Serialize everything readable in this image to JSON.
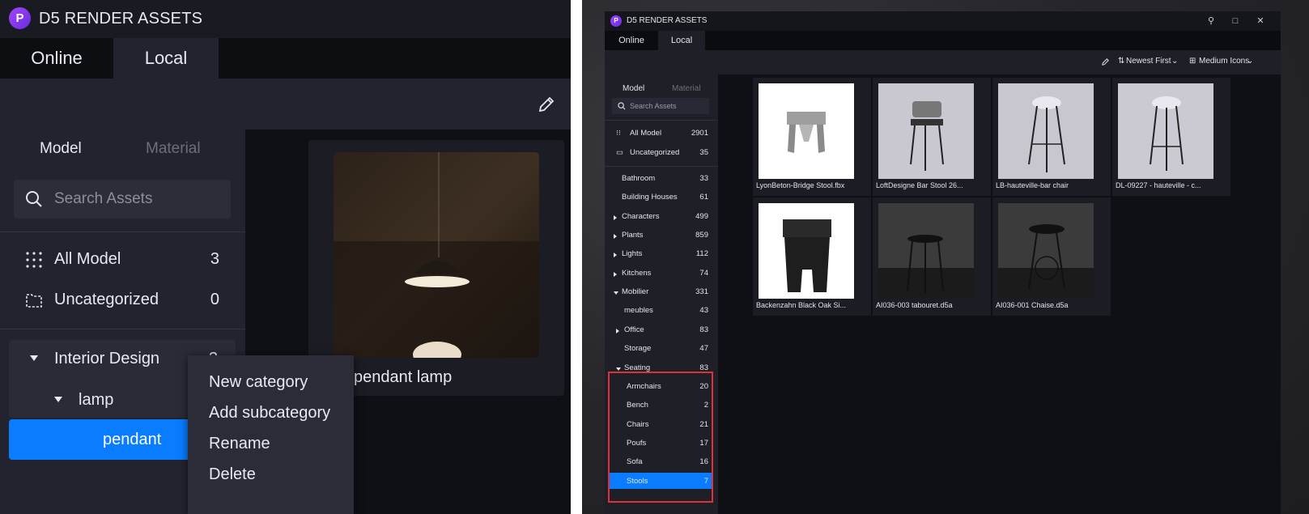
{
  "left": {
    "app_title": "D5 RENDER ASSETS",
    "logo_letter": "P",
    "tabs": {
      "online": "Online",
      "local": "Local"
    },
    "sidebar_tabs": {
      "model": "Model",
      "material": "Material"
    },
    "search_placeholder": "Search Assets",
    "all_model": {
      "label": "All Model",
      "count": "3"
    },
    "uncategorized": {
      "label": "Uncategorized",
      "count": "0"
    },
    "tree": {
      "interior_design": {
        "label": "Interior Design",
        "count": "3"
      },
      "lamp": "lamp",
      "pendant": "pendant"
    },
    "card_label": "pendant lamp",
    "context_menu": [
      "New category",
      "Add subcategory",
      "Rename",
      "Delete"
    ]
  },
  "right": {
    "app_title": "D5 RENDER ASSETS",
    "logo_letter": "P",
    "tabs": {
      "online": "Online",
      "local": "Local"
    },
    "toolbar": {
      "sort": "Newest First",
      "view": "Medium Icons"
    },
    "sidebar_tabs": {
      "model": "Model",
      "material": "Material"
    },
    "search_placeholder": "Search Assets",
    "all_model": {
      "label": "All Model",
      "count": "2901"
    },
    "uncategorized": {
      "label": "Uncategorized",
      "count": "35"
    },
    "categories": [
      {
        "label": "Bathroom",
        "count": "33"
      },
      {
        "label": "Building Houses",
        "count": "61"
      },
      {
        "label": "Characters",
        "count": "499"
      },
      {
        "label": "Plants",
        "count": "859"
      },
      {
        "label": "Lights",
        "count": "112"
      },
      {
        "label": "Kitchens",
        "count": "74"
      },
      {
        "label": "Mobilier",
        "count": "331"
      },
      {
        "label": "meubles",
        "count": "43"
      },
      {
        "label": "Office",
        "count": "83"
      },
      {
        "label": "Storage",
        "count": "47"
      },
      {
        "label": "Seating",
        "count": "83"
      },
      {
        "label": "Armchairs",
        "count": "20"
      },
      {
        "label": "Bench",
        "count": "2"
      },
      {
        "label": "Chairs",
        "count": "21"
      },
      {
        "label": "Poufs",
        "count": "17"
      },
      {
        "label": "Sofa",
        "count": "16"
      },
      {
        "label": "Stools",
        "count": "7"
      }
    ],
    "assets": [
      "LyonBeton-Bridge Stool.fbx",
      "LoftDesigne Bar Stool 26...",
      "LB-hauteville-bar chair",
      "DL-09227 - hauteville - c...",
      "Backenzahn Black Oak Si...",
      "AI036-003 tabouret.d5a",
      "AI036-001 Chaise.d5a"
    ],
    "accent_color": "#0a7cff",
    "highlight_color": "#e0303a"
  }
}
